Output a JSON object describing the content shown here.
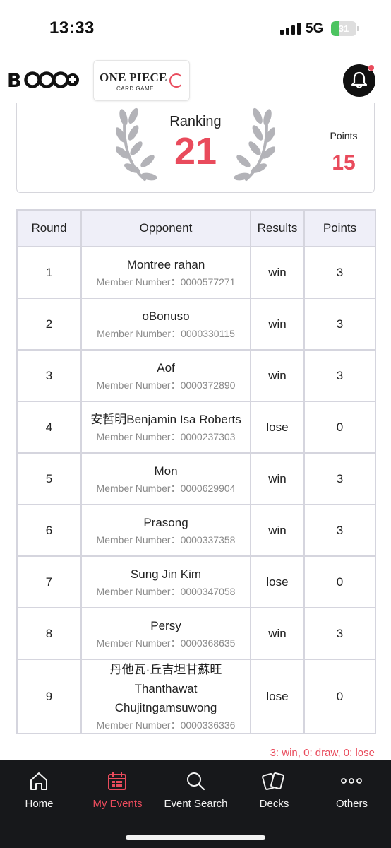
{
  "status_bar": {
    "time": "13:33",
    "network": "5G",
    "battery": "31",
    "battery_level_percent": 31
  },
  "header": {
    "brand_logo": "B",
    "game_logo_title": "ONE PIECE",
    "game_logo_subtitle": "CARD GAME",
    "notification_badge": true
  },
  "summary": {
    "ranking_label": "Ranking",
    "ranking_value": "21",
    "points_label": "Points",
    "points_value": "15"
  },
  "table": {
    "headers": {
      "round": "Round",
      "opponent": "Opponent",
      "results": "Results",
      "points": "Points"
    },
    "rows": [
      {
        "round": "1",
        "name": "Montree rahan",
        "member": "Member Number：0000577271",
        "result": "win",
        "points": "3"
      },
      {
        "round": "2",
        "name": "oBonuso",
        "member": "Member Number：0000330115",
        "result": "win",
        "points": "3"
      },
      {
        "round": "3",
        "name": "Aof",
        "member": "Member Number：0000372890",
        "result": "win",
        "points": "3"
      },
      {
        "round": "4",
        "name": "安哲明Benjamin Isa Roberts",
        "member": "Member Number：0000237303",
        "result": "lose",
        "points": "0"
      },
      {
        "round": "5",
        "name": "Mon",
        "member": "Member Number：0000629904",
        "result": "win",
        "points": "3"
      },
      {
        "round": "6",
        "name": "Prasong",
        "member": "Member Number：0000337358",
        "result": "win",
        "points": "3"
      },
      {
        "round": "7",
        "name": "Sung Jin Kim",
        "member": "Member Number：0000347058",
        "result": "lose",
        "points": "0"
      },
      {
        "round": "8",
        "name": "Persy",
        "member": "Member Number：0000368635",
        "result": "win",
        "points": "3"
      },
      {
        "round": "9",
        "name": "丹他瓦·丘吉坦甘蘇旺 Thanthawat Chujitngamsuwong",
        "member": "Member Number：0000336336",
        "result": "lose",
        "points": "0"
      }
    ]
  },
  "legend_note": "3: win, 0: draw, 0: lose",
  "nav": {
    "items": [
      {
        "label": "Home",
        "icon": "home-icon"
      },
      {
        "label": "My Events",
        "icon": "calendar-icon"
      },
      {
        "label": "Event Search",
        "icon": "search-icon"
      },
      {
        "label": "Decks",
        "icon": "cards-icon"
      },
      {
        "label": "Others",
        "icon": "more-icon"
      }
    ],
    "active_index": 1
  },
  "colors": {
    "accent": "#e94b5c",
    "nav_bg": "#17181b",
    "table_header_bg": "#efeff8",
    "battery_green": "#4cc460"
  }
}
